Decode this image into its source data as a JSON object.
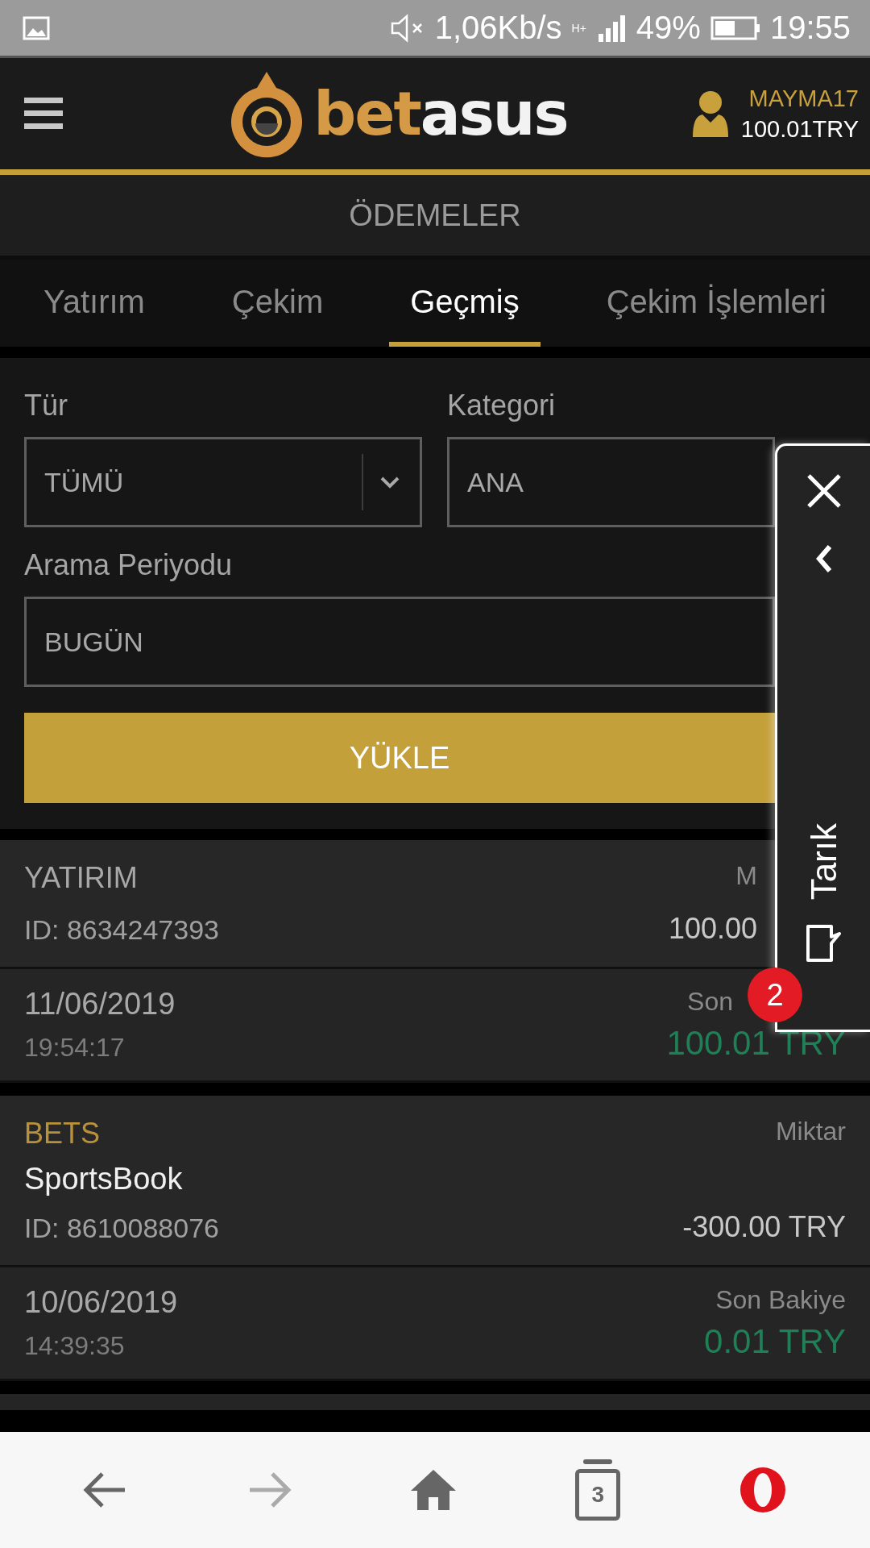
{
  "status_bar": {
    "speed": "1,06Kb/s",
    "network": "H+",
    "battery": "49%",
    "time": "19:55"
  },
  "header": {
    "logo_parts": [
      "bet",
      "asus"
    ],
    "username": "MAYMA17",
    "balance": "100.01TRY"
  },
  "page_title": "ÖDEMELER",
  "tabs": [
    {
      "label": "Yatırım",
      "selected": false
    },
    {
      "label": "Çekim",
      "selected": false
    },
    {
      "label": "Geçmiş",
      "selected": true
    },
    {
      "label": "Çekim İşlemleri",
      "selected": false
    }
  ],
  "filters": [
    {
      "label": "Tür",
      "value": "TÜMÜ",
      "kind": "select"
    },
    {
      "label": "Kategori",
      "value": "ANA",
      "kind": "text"
    },
    {
      "label": "Arama Periyodu",
      "value": "BUGÜN",
      "kind": "text"
    }
  ],
  "load_button": "YÜKLE",
  "transactions": [
    {
      "type": "YATIRIM",
      "color": "#a8a8a8",
      "id": "ID: 8634247393",
      "amount_label": "M",
      "amount": "100.00",
      "date": "11/06/2019",
      "time": "19:54:17",
      "balance_label": "Son",
      "balance": "100.01 TRY"
    },
    {
      "type": "BETS",
      "color": "#b8913a",
      "name": "SportsBook",
      "id": "ID: 8610088076",
      "amount_label": "Miktar",
      "amount": "-300.00 TRY",
      "date": "10/06/2019",
      "time": "14:39:35",
      "balance_label": "Son Bakiye",
      "balance": "0.01 TRY"
    }
  ],
  "side_panel": {
    "label": "Tarık",
    "badge": "2"
  },
  "nav_bar": {
    "tab_count": "3"
  }
}
